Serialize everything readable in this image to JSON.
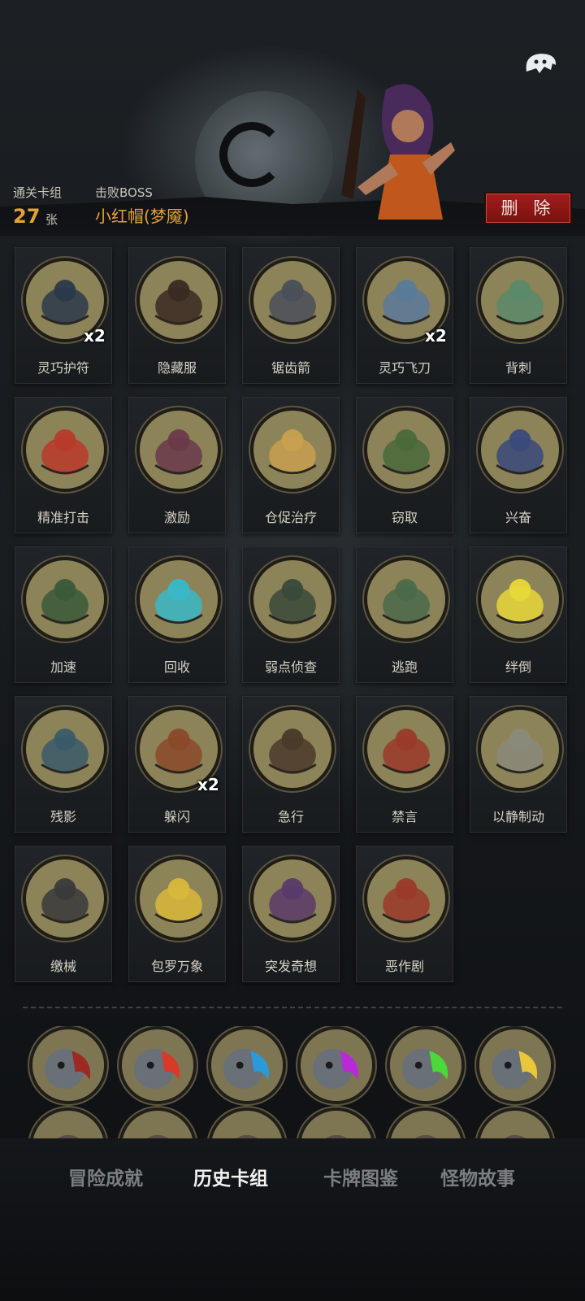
{
  "header": {
    "deck_label": "通关卡组",
    "deck_count": "27",
    "deck_unit": "张",
    "boss_label": "击败BOSS",
    "boss_name": "小红帽(梦魇)",
    "delete_label": "删 除"
  },
  "cards": [
    {
      "name": "灵巧护符",
      "count": "x2",
      "icon": "amulet-icon"
    },
    {
      "name": "隐藏服",
      "count": "",
      "icon": "hooded-cloak-icon"
    },
    {
      "name": "锯齿箭",
      "count": "",
      "icon": "serrated-arrow-icon"
    },
    {
      "name": "灵巧飞刀",
      "count": "x2",
      "icon": "flying-knife-icon"
    },
    {
      "name": "背刺",
      "count": "",
      "icon": "backstab-icon"
    },
    {
      "name": "精准打击",
      "count": "",
      "icon": "target-icon"
    },
    {
      "name": "激励",
      "count": "",
      "icon": "hammer-icon"
    },
    {
      "name": "仓促治疗",
      "count": "",
      "icon": "bandage-icon"
    },
    {
      "name": "窃取",
      "count": "",
      "icon": "goblin-icon"
    },
    {
      "name": "兴奋",
      "count": "",
      "icon": "dwarf-icon"
    },
    {
      "name": "加速",
      "count": "",
      "icon": "witch-icon"
    },
    {
      "name": "回收",
      "count": "",
      "icon": "swirl-icon"
    },
    {
      "name": "弱点侦查",
      "count": "",
      "icon": "wolf-icon"
    },
    {
      "name": "逃跑",
      "count": "",
      "icon": "runner-icon"
    },
    {
      "name": "绊倒",
      "count": "",
      "icon": "trip-icon"
    },
    {
      "name": "残影",
      "count": "",
      "icon": "afterimage-icon"
    },
    {
      "name": "躲闪",
      "count": "x2",
      "icon": "dodge-icon"
    },
    {
      "name": "急行",
      "count": "",
      "icon": "dash-icon"
    },
    {
      "name": "禁言",
      "count": "",
      "icon": "red-hood-icon"
    },
    {
      "name": "以静制动",
      "count": "",
      "icon": "skull-icon"
    },
    {
      "name": "缴械",
      "count": "",
      "icon": "disarm-icon"
    },
    {
      "name": "包罗万象",
      "count": "",
      "icon": "chessboard-icon"
    },
    {
      "name": "突发奇想",
      "count": "",
      "icon": "idea-icon"
    },
    {
      "name": "恶作剧",
      "count": "",
      "icon": "prank-icon"
    }
  ],
  "portraits": [
    {
      "icon": "hooded-figure-icon",
      "accent": "#9a2a22"
    },
    {
      "icon": "monster-red-icon",
      "accent": "#d83a2a"
    },
    {
      "icon": "monster-blue-icon",
      "accent": "#2a9ad8"
    },
    {
      "icon": "monster-purple-icon",
      "accent": "#b82ad8"
    },
    {
      "icon": "monster-green-icon",
      "accent": "#4ad83a"
    },
    {
      "icon": "monster-yellow-icon",
      "accent": "#e8c83a"
    }
  ],
  "tabs": [
    {
      "label": "冒险成就",
      "active": false
    },
    {
      "label": "历史卡组",
      "active": true
    },
    {
      "label": "卡牌图鉴",
      "active": false
    },
    {
      "label": "怪物故事",
      "active": false
    }
  ],
  "colors": {
    "accent": "#e6a23a",
    "delete": "#a11d1d",
    "card_face": "#8c8358"
  }
}
